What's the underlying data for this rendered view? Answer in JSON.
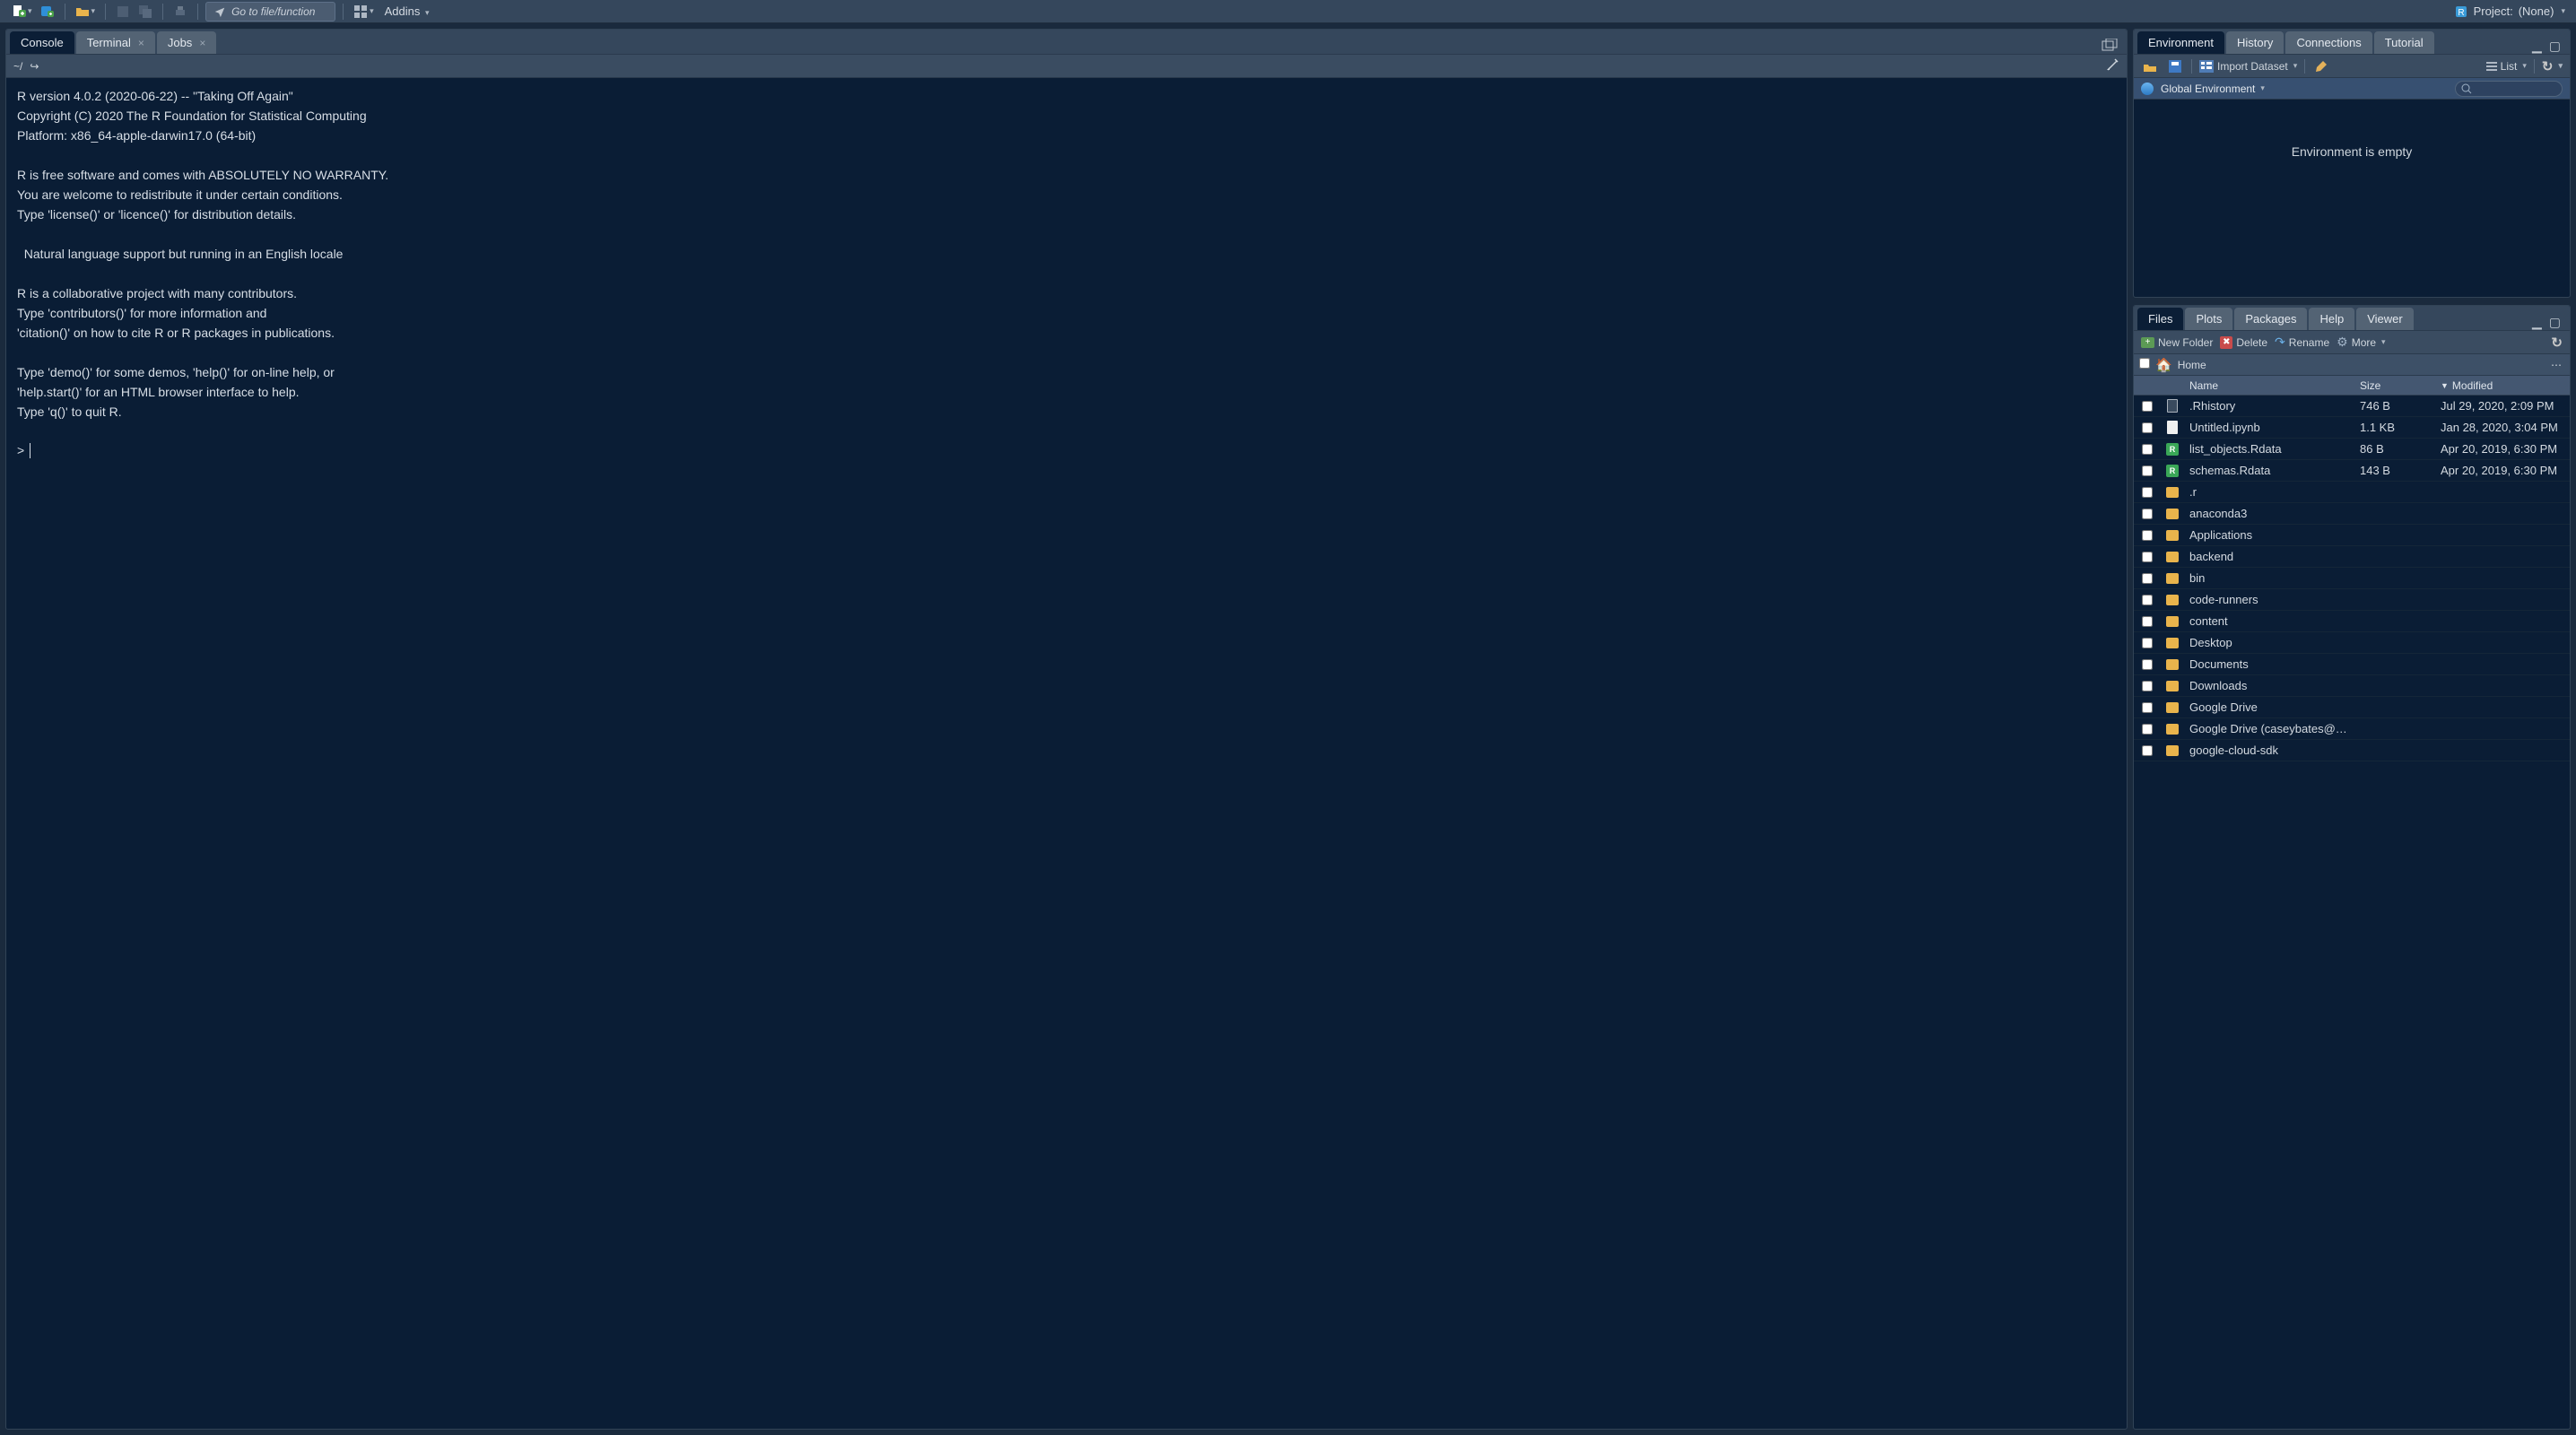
{
  "toolbar": {
    "goto_placeholder": "Go to file/function",
    "addins_label": "Addins"
  },
  "project": {
    "label": "Project:",
    "value": "(None)"
  },
  "left_tabs": [
    "Console",
    "Terminal",
    "Jobs"
  ],
  "console": {
    "path": "~/",
    "text": "R version 4.0.2 (2020-06-22) -- \"Taking Off Again\"\nCopyright (C) 2020 The R Foundation for Statistical Computing\nPlatform: x86_64-apple-darwin17.0 (64-bit)\n\nR is free software and comes with ABSOLUTELY NO WARRANTY.\nYou are welcome to redistribute it under certain conditions.\nType 'license()' or 'licence()' for distribution details.\n\n  Natural language support but running in an English locale\n\nR is a collaborative project with many contributors.\nType 'contributors()' for more information and\n'citation()' on how to cite R or R packages in publications.\n\nType 'demo()' for some demos, 'help()' for on-line help, or\n'help.start()' for an HTML browser interface to help.\nType 'q()' to quit R.\n",
    "prompt": ">"
  },
  "env_tabs": [
    "Environment",
    "History",
    "Connections",
    "Tutorial"
  ],
  "env_bar": {
    "import_label": "Import Dataset",
    "list_label": "List",
    "scope_label": "Global Environment",
    "empty_text": "Environment is empty"
  },
  "files_tabs": [
    "Files",
    "Plots",
    "Packages",
    "Help",
    "Viewer"
  ],
  "files_bar": {
    "new_folder": "New Folder",
    "delete": "Delete",
    "rename": "Rename",
    "more": "More"
  },
  "files_path": "Home",
  "files_columns": {
    "name": "Name",
    "size": "Size",
    "modified": "Modified"
  },
  "files": [
    {
      "icon": "doc-dark",
      "name": ".Rhistory",
      "size": "746 B",
      "modified": "Jul 29, 2020, 2:09 PM"
    },
    {
      "icon": "doc",
      "name": "Untitled.ipynb",
      "size": "1.1 KB",
      "modified": "Jan 28, 2020, 3:04 PM"
    },
    {
      "icon": "rdata",
      "name": "list_objects.Rdata",
      "size": "86 B",
      "modified": "Apr 20, 2019, 6:30 PM"
    },
    {
      "icon": "rdata",
      "name": "schemas.Rdata",
      "size": "143 B",
      "modified": "Apr 20, 2019, 6:30 PM"
    },
    {
      "icon": "folder",
      "name": ".r",
      "size": "",
      "modified": ""
    },
    {
      "icon": "folder",
      "name": "anaconda3",
      "size": "",
      "modified": ""
    },
    {
      "icon": "folder",
      "name": "Applications",
      "size": "",
      "modified": ""
    },
    {
      "icon": "folder",
      "name": "backend",
      "size": "",
      "modified": ""
    },
    {
      "icon": "folder",
      "name": "bin",
      "size": "",
      "modified": ""
    },
    {
      "icon": "folder",
      "name": "code-runners",
      "size": "",
      "modified": ""
    },
    {
      "icon": "folder",
      "name": "content",
      "size": "",
      "modified": ""
    },
    {
      "icon": "folder",
      "name": "Desktop",
      "size": "",
      "modified": ""
    },
    {
      "icon": "folder",
      "name": "Documents",
      "size": "",
      "modified": ""
    },
    {
      "icon": "folder",
      "name": "Downloads",
      "size": "",
      "modified": ""
    },
    {
      "icon": "folder",
      "name": "Google Drive",
      "size": "",
      "modified": ""
    },
    {
      "icon": "folder",
      "name": "Google Drive (caseybates@gmai…",
      "size": "",
      "modified": ""
    },
    {
      "icon": "folder",
      "name": "google-cloud-sdk",
      "size": "",
      "modified": ""
    }
  ]
}
